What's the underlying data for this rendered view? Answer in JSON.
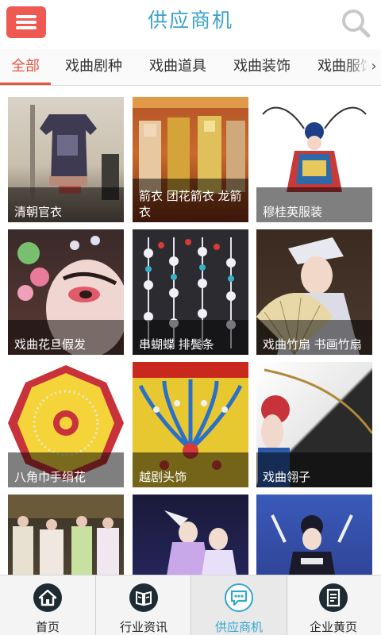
{
  "header": {
    "title": "供应商机",
    "menu_icon": "hamburger-menu-icon",
    "search_icon": "search-icon",
    "accent_color": "#ee5a52",
    "title_color": "#3aa3c9"
  },
  "tabs": [
    {
      "label": "全部",
      "active": true
    },
    {
      "label": "戏曲剧种",
      "active": false
    },
    {
      "label": "戏曲道具",
      "active": false
    },
    {
      "label": "戏曲装饰",
      "active": false
    },
    {
      "label": "戏曲服饰",
      "active": false
    }
  ],
  "tabs_more_label": "›",
  "products": [
    {
      "caption": "清朝官衣"
    },
    {
      "caption": "箭衣 团花箭衣 龙箭衣"
    },
    {
      "caption": "穆桂英服装"
    },
    {
      "caption": "戏曲花旦假发"
    },
    {
      "caption": "串蝴蝶 排鬓条"
    },
    {
      "caption": "戏曲竹扇 书画竹扇"
    },
    {
      "caption": "八角巾手绢花"
    },
    {
      "caption": "越剧头饰"
    },
    {
      "caption": "戏曲翎子"
    },
    {
      "caption": ""
    },
    {
      "caption": ""
    },
    {
      "caption": ""
    }
  ],
  "bottom_nav": [
    {
      "label": "首页",
      "icon": "home-icon",
      "active": false
    },
    {
      "label": "行业资讯",
      "icon": "book-icon",
      "active": false
    },
    {
      "label": "供应商机",
      "icon": "chat-bubble-icon",
      "active": true
    },
    {
      "label": "企业黄页",
      "icon": "document-icon",
      "active": false
    }
  ],
  "active_color": "#34a7cf"
}
